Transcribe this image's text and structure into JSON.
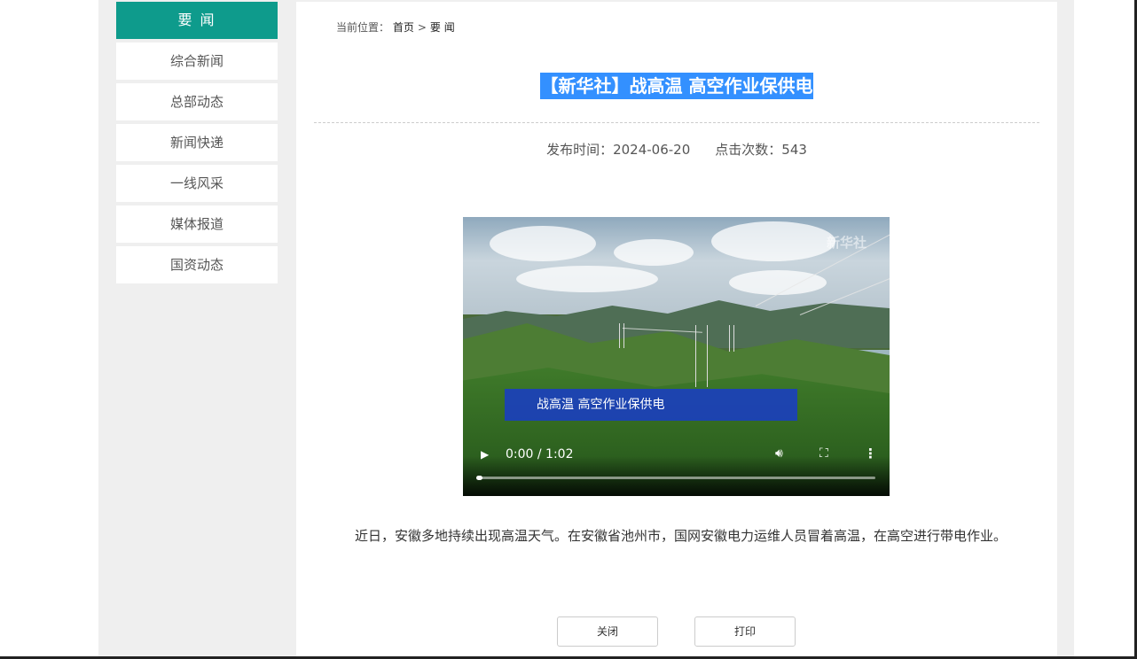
{
  "sidebar": {
    "header": "要 闻",
    "items": [
      {
        "label": "综合新闻"
      },
      {
        "label": "总部动态"
      },
      {
        "label": "新闻快递"
      },
      {
        "label": "一线风采"
      },
      {
        "label": "媒体报道"
      },
      {
        "label": "国资动态"
      }
    ]
  },
  "breadcrumb": {
    "prefix": "当前位置：",
    "home": "首页",
    "separator": ">",
    "current": "要 闻"
  },
  "article": {
    "title": "【新华社】战高温 高空作业保供电",
    "publish_label": "发布时间：",
    "publish_date": "2024-06-20",
    "clicks_label": "点击次数：",
    "clicks": "543",
    "body": "近日，安徽多地持续出现高温天气。在安徽省池州市，国网安徽电力运维人员冒着高温，在高空进行带电作业。"
  },
  "video": {
    "caption": "战高温 高空作业保供电",
    "watermark": "新华社",
    "time": "0:00 / 1:02",
    "progress": 0.0,
    "icons": {
      "play": "play-icon",
      "volume": "volume-icon",
      "fullscreen": "fullscreen-icon",
      "more": "more-vert-icon"
    }
  },
  "buttons": {
    "close": "关闭",
    "print": "打印"
  },
  "colors": {
    "accent": "#0e9b8c",
    "title_highlight": "#3390ff",
    "caption_bg": "#193cc8"
  }
}
